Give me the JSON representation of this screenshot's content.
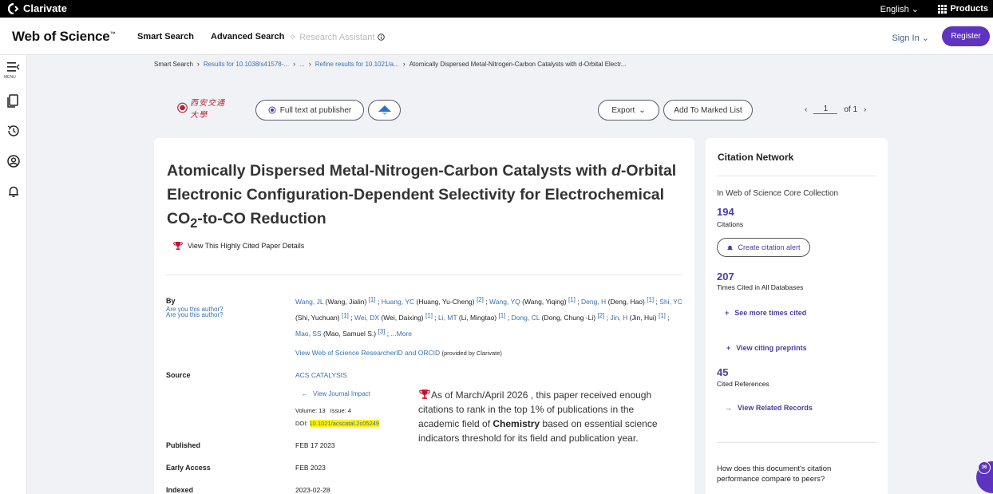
{
  "topbar": {
    "brand": "Clarivate",
    "language": "English",
    "products": "Products"
  },
  "navbar": {
    "logo": "Web of Science",
    "smart_search": "Smart Search",
    "advanced_search": "Advanced Search",
    "research_assistant": "Research Assistant",
    "sign_in": "Sign In",
    "register": "Register"
  },
  "sidebar": {
    "menu_label": "MENU"
  },
  "breadcrumb": {
    "items": [
      "Smart Search",
      "Results for 10.1038/s41578-...",
      "...",
      "Refine results for 10.1021/a...",
      "Atomically Dispersed Metal-Nitrogen-Carbon Catalysts with d-Orbital Electr..."
    ]
  },
  "actions": {
    "university_logo_text": "西安交通大學",
    "full_text": "Full text at publisher",
    "export": "Export",
    "add_marked": "Add To Marked List",
    "page_current": "1",
    "page_of": "of 1"
  },
  "record": {
    "title_part1": "Atomically Dispersed Metal-Nitrogen-Carbon Catalysts with ",
    "title_d": "d",
    "title_part2": "-Orbital Electronic Configuration-Dependent Selectivity for Electrochemical CO",
    "title_sub": "2",
    "title_part3": "-to-CO Reduction",
    "highly_cited_link": "View This Highly Cited Paper Details",
    "by_label": "By",
    "are_you_author": "Are you this author?",
    "authors": [
      {
        "short": "Wang, JL",
        "full": "(Wang, Jialin)",
        "ref": "[1]",
        "sep": ";"
      },
      {
        "short": "Huang, YC",
        "full": "(Huang, Yu-Cheng)",
        "ref": "[2]",
        "sep": ";"
      },
      {
        "short": "Wang, YQ",
        "full": "(Wang, Yiqing)",
        "ref": "[1]",
        "sep": ";"
      },
      {
        "short": "Deng, H",
        "full": "(Deng, Hao)",
        "ref": "[1]",
        "sep": ";"
      },
      {
        "short": "Shi, YC",
        "full": "(Shi, Yuchuan)",
        "ref": "[1]",
        "sep": ";"
      },
      {
        "short": "Wei, DX",
        "full": "(Wei, Daixing)",
        "ref": "[1]",
        "sep": ";"
      },
      {
        "short": "Li, MT",
        "full": "(Li, Mingtao)",
        "ref": "[1]",
        "sep": ";"
      },
      {
        "short": "Dong, CL",
        "full": "(Dong, Chung -Li)",
        "ref": "[2]",
        "sep": ";"
      },
      {
        "short": "Jin, H",
        "full": "(Jin, Hui)",
        "ref": "[1]",
        "sep": ";"
      },
      {
        "short": "Mao, SS",
        "full": "(Mao, Samuel S.)",
        "ref": "[3]",
        "sep": ";"
      }
    ],
    "more": "...More",
    "researcher_id": "View Web of Science ResearcherID and ORCID",
    "provided_by": "(provided by Clarivate)",
    "source_label": "Source",
    "source_value": "ACS CATALYSIS",
    "journal_impact": "View Journal Impact",
    "volume": "Volume: 13",
    "issue": "Issue: 4",
    "doi_label": "DOI:",
    "doi_value": "10.1021/acscatal.2c05249",
    "published_label": "Published",
    "published_value": "FEB 17 2023",
    "early_access_label": "Early Access",
    "early_access_value": "FEB 2023",
    "indexed_label": "Indexed",
    "indexed_value": "2023-02-28",
    "hc_note_part1": "As of March/April 2026 , this paper received enough citations to rank in the top 1% of publications in the academic field of ",
    "hc_note_field": "Chemistry",
    "hc_note_part2": " based on essential science indicators threshold for its field and publication year."
  },
  "citation_network": {
    "title": "Citation Network",
    "collection": "In Web of Science Core Collection",
    "citations_count": "194",
    "citations_label": "Citations",
    "create_alert": "Create citation alert",
    "times_cited_count": "207",
    "times_cited_label": "Times Cited in All Databases",
    "see_more": "See more times cited",
    "view_preprints": "View citing preprints",
    "cited_refs_count": "45",
    "cited_refs_label": "Cited References",
    "related_records": "View Related Records",
    "question": "How does this document's citation performance compare to peers?"
  },
  "floating": {
    "count": "36"
  },
  "colors": {
    "accent": "#5e33bf",
    "link": "#3571b8",
    "number": "#4e3aa4",
    "highlight": "#fff200",
    "trophy": "#c8102e"
  }
}
